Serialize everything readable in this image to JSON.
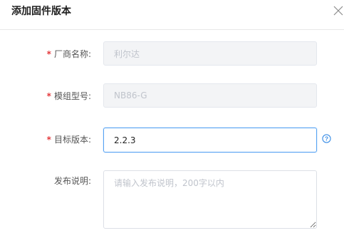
{
  "dialog": {
    "title": "添加固件版本"
  },
  "icons": {
    "close": "close-icon",
    "help": "question-circle-icon"
  },
  "colors": {
    "required_star": "#e4393c",
    "focus_border": "#57a3f3",
    "help_icon": "#3a8ee6"
  },
  "form": {
    "manufacturer": {
      "label": "厂商名称:",
      "required": true,
      "value": "利尔达",
      "disabled": true
    },
    "module_model": {
      "label": "模组型号:",
      "required": true,
      "value": "NB86-G",
      "disabled": true
    },
    "target_version": {
      "label": "目标版本:",
      "required": true,
      "value": "2.2.3",
      "focused": true
    },
    "release_notes": {
      "label": "发布说明:",
      "required": false,
      "value": "",
      "placeholder": "请输入发布说明，200字以内"
    }
  }
}
